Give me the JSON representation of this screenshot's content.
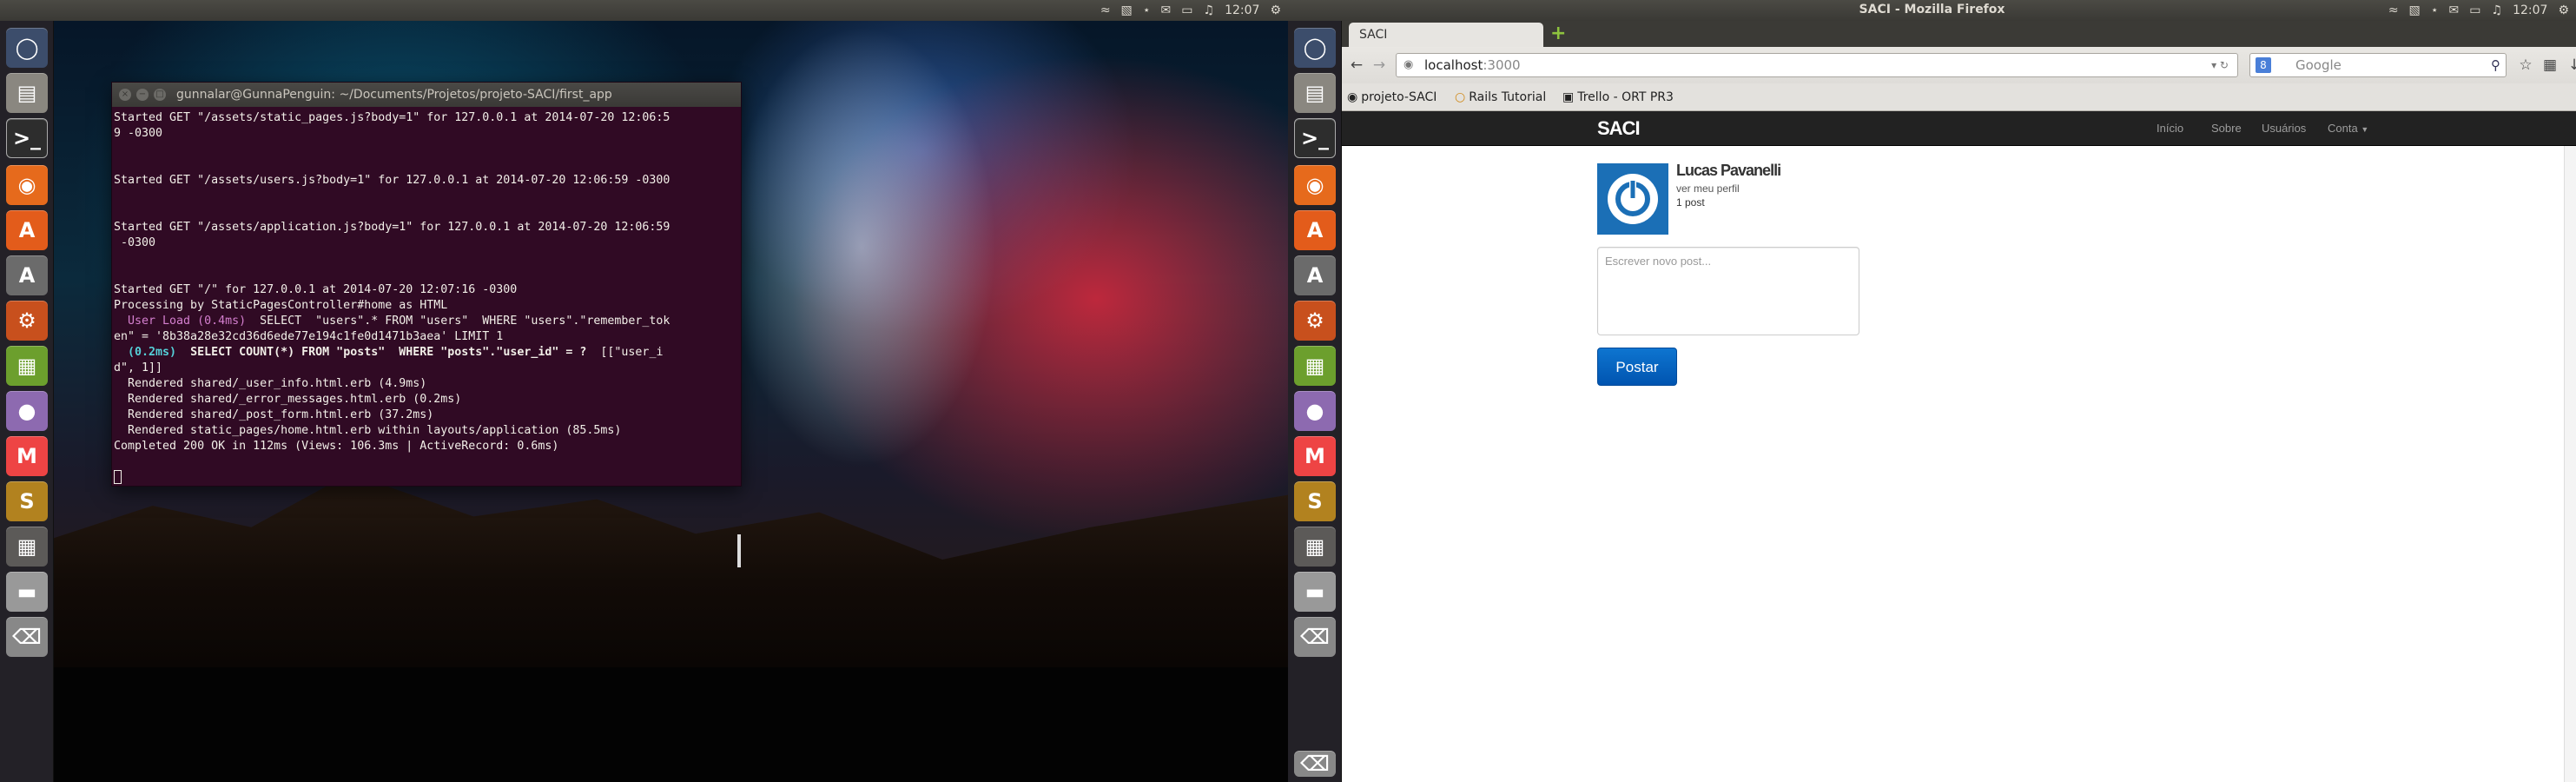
{
  "screen1": {
    "tray": {
      "time": "12:07"
    },
    "terminal": {
      "title": "gunnalar@GunnaPenguin: ~/Documents/Projetos/projeto-SACI/first_app",
      "lines": [
        "Started GET \"/assets/static_pages.js?body=1\" for 127.0.0.1 at 2014-07-20 12:06:5",
        "9 -0300",
        "",
        "",
        "Started GET \"/assets/users.js?body=1\" for 127.0.0.1 at 2014-07-20 12:06:59 -0300",
        "",
        "",
        "Started GET \"/assets/application.js?body=1\" for 127.0.0.1 at 2014-07-20 12:06:59",
        " -0300",
        "",
        "",
        "Started GET \"/\" for 127.0.0.1 at 2014-07-20 12:07:16 -0300",
        "Processing by StaticPagesController#home as HTML"
      ],
      "userload_label": "  User Load (0.4ms)",
      "userload_sql": "  SELECT  \"users\".* FROM \"users\"  WHERE \"users\".\"remember_tok",
      "userload_sql2": "en\" = '8b38a28e32cd36d6ede77e194c1fe0d1471b3aea' LIMIT 1",
      "count_label": "  (0.2ms)",
      "count_sql": "  SELECT COUNT(*) FROM \"posts\"  WHERE \"posts\".\"user_id\" = ?",
      "count_sql_tail": "  [[\"user_i",
      "count_sql2": "d\", 1]]",
      "rendered": [
        "  Rendered shared/_user_info.html.erb (4.9ms)",
        "  Rendered shared/_error_messages.html.erb (0.2ms)",
        "  Rendered shared/_post_form.html.erb (37.2ms)",
        "  Rendered static_pages/home.html.erb within layouts/application (85.5ms)",
        "Completed 200 OK in 112ms (Views: 106.3ms | ActiveRecord: 0.6ms)"
      ]
    }
  },
  "screen2": {
    "window_title": "SACI - Mozilla Firefox",
    "tray": {
      "time": "12:07"
    },
    "tab_title": "SACI",
    "url_host": "localhost",
    "url_port": ":3000",
    "search_placeholder": "Google",
    "bookmarks": [
      "projeto-SACI",
      "Rails Tutorial",
      "Trello - ORT PR3"
    ],
    "app": {
      "brand": "SACI",
      "nav": [
        "Início",
        "Sobre",
        "Usuários",
        "Conta"
      ],
      "user_name": "Lucas Pavanelli",
      "profile_link": "ver meu perfil",
      "post_count": "1 post",
      "textarea_placeholder": "Escrever novo post...",
      "submit_label": "Postar"
    }
  }
}
